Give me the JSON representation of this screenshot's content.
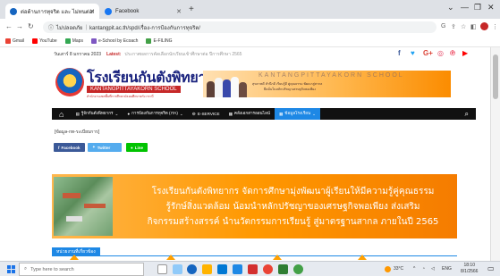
{
  "browser": {
    "tabs": [
      {
        "title": "ต่อต้านการทุจริต และ ไม่ทนต่อการทุจริต",
        "icon": "school-favicon-icon",
        "color": "#1565c0"
      },
      {
        "title": "Facebook",
        "icon": "facebook-favicon-icon",
        "color": "#1877f2"
      }
    ],
    "newtab": "+",
    "window_controls": [
      "⌄",
      "—",
      "❐",
      "✕"
    ],
    "address_secure": "ไม่ปลอดภัย",
    "address_url": "kantangpit.ac.th/spd/เรื่อง-การป้องกันการทุจริต/",
    "bookmarks": [
      "Gmail",
      "YouTube",
      "Maps",
      "e-School by Ecoach",
      "E-FILING"
    ]
  },
  "site": {
    "date": "วันเสาร์ 8 มกราคม 2023",
    "latest_label": "Latest:",
    "latest_news": "ประกาศผลการคัดเลือกนักเรียนเข้าศึกษาต่อ ปีการศึกษา 2565",
    "school_name_th": "โรงเรียนกันตังพิทยากร",
    "school_name_en": "KANTANGPITTAYAKORN SCHOOL",
    "school_sub": "สำนักงานเขตพื้นที่การศึกษามัธยมศึกษาตรัง กระบี่",
    "header_banner": {
      "title": "KANTANGPITTAYAKORN SCHOOL",
      "line1": "สุขภาพดี สำนึกดี เรียนรู้ดี คู่คุณธรรม พัฒนาสู่สากล",
      "line2": "ยึดมั่นในหลักปรัชญาเศรษฐกิจพอเพียง"
    },
    "nav": {
      "items": [
        {
          "label": "รู้จักกันตังพิทยากร",
          "caret": "⌄",
          "active": false
        },
        {
          "label": "การป้องกันการทุจริต (ITA)",
          "caret": "⌄",
          "active": false
        },
        {
          "label": "E-SERVICE",
          "caret": "",
          "active": false
        },
        {
          "label": "คลังเอกสารออนไลน์",
          "caret": "",
          "active": false
        },
        {
          "label": "ข้อมูลโรงเรียน",
          "caret": "⌄",
          "active": true
        }
      ]
    },
    "breadcrumb": "[ข้อมูล-กท-ระเบียบการ]",
    "share": [
      {
        "label": "Facebook",
        "icon": "facebook-icon",
        "color": "#3b5998"
      },
      {
        "label": "Twitter",
        "icon": "twitter-icon",
        "color": "#55acee"
      },
      {
        "label": "Line",
        "icon": "line-icon",
        "color": "#00c300"
      }
    ],
    "banner": {
      "line1": "โรงเรียนกันตังพิทยากร จัดการศึกษามุ่งพัฒนาผู้เรียนให้มีความรู้คู่คุณธรรม",
      "line2": "รู้รักษ์สิ่งแวดล้อม น้อมนำหลักปรัชญาของเศรษฐกิจพอเพียง ส่งเสริม",
      "line3": "กิจกรรมสร้างสรรค์ นำนวัตกรรมการเรียนรู้ สู่มาตรฐานสากล ภายในปี 2565"
    },
    "section_title": "หน่วยงานที่เกี่ยวข้อง"
  },
  "taskbar": {
    "search_placeholder": "Type here to search",
    "weather": "33°C",
    "time": "18:10",
    "date": "8/1/2566",
    "lang": "ENG"
  },
  "colors": {
    "accent": "#1e88e5",
    "nav_bg": "#111111",
    "brand_red": "#c62828",
    "banner_orange": "#ff9800"
  }
}
